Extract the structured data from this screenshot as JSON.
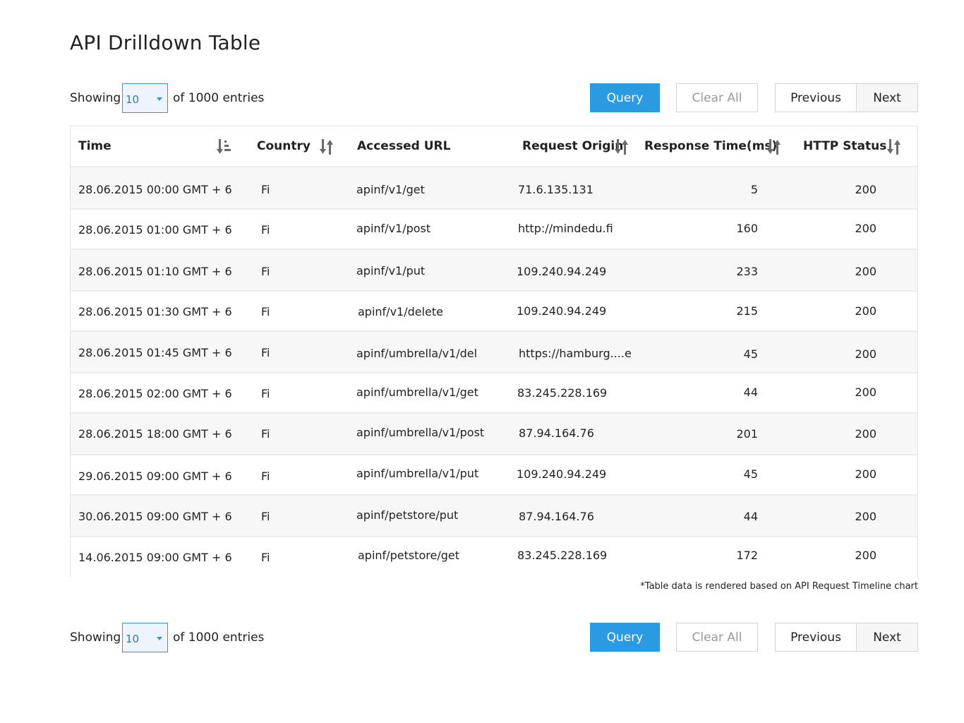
{
  "page": {
    "title": "API Drilldown Table"
  },
  "pagination": {
    "showing_label": "Showing",
    "page_size": "10",
    "entries_label": "of 1000 entries",
    "query_label": "Query",
    "clear_label": "Clear All",
    "previous_label": "Previous",
    "next_label": "Next"
  },
  "table": {
    "columns": [
      {
        "label": "Time",
        "sort_icon": "sort-desc-icon"
      },
      {
        "label": "Country",
        "sort_icon": "sort-icon"
      },
      {
        "label": "Accessed URL",
        "sort_icon": ""
      },
      {
        "label": "Request Origin",
        "sort_icon": "sort-icon"
      },
      {
        "label": "Response Time(ms)",
        "sort_icon": "sort-icon"
      },
      {
        "label": "HTTP Status",
        "sort_icon": "sort-icon"
      }
    ],
    "rows": [
      {
        "time": "28.06.2015  00:00 GMT + 6",
        "country": "Fi",
        "url": "apinf/v1/get",
        "origin": "71.6.135.131",
        "response_time": "5",
        "status": "200"
      },
      {
        "time": "28.06.2015  01:00 GMT + 6",
        "country": "Fi",
        "url": "apinf/v1/post",
        "origin": "http://mindedu.fi",
        "response_time": "160",
        "status": "200"
      },
      {
        "time": "28.06.2015  01:10 GMT + 6",
        "country": "Fi",
        "url": "apinf/v1/put",
        "origin": "109.240.94.249",
        "response_time": "233",
        "status": "200"
      },
      {
        "time": "28.06.2015  01:30 GMT + 6",
        "country": "Fi",
        "url": "apinf/v1/delete",
        "origin": "109.240.94.249",
        "response_time": "215",
        "status": "200"
      },
      {
        "time": "28.06.2015  01:45 GMT + 6",
        "country": "Fi",
        "url": "apinf/umbrella/v1/del",
        "origin": "https://hamburg....e",
        "response_time": "45",
        "status": "200"
      },
      {
        "time": "28.06.2015  02:00 GMT + 6",
        "country": "Fi",
        "url": "apinf/umbrella/v1/get",
        "origin": "83.245.228.169",
        "response_time": "44",
        "status": "200"
      },
      {
        "time": "28.06.2015  18:00 GMT + 6",
        "country": "Fi",
        "url": "apinf/umbrella/v1/post",
        "origin": "87.94.164.76",
        "response_time": "201",
        "status": "200"
      },
      {
        "time": "29.06.2015  09:00 GMT + 6",
        "country": "Fi",
        "url": "apinf/umbrella/v1/put",
        "origin": "109.240.94.249",
        "response_time": "45",
        "status": "200"
      },
      {
        "time": "30.06.2015  09:00 GMT + 6",
        "country": "Fi",
        "url": "apinf/petstore/put",
        "origin": "87.94.164.76",
        "response_time": "44",
        "status": "200"
      },
      {
        "time": "14.06.2015  09:00 GMT + 6",
        "country": "Fi",
        "url": "apinf/petstore/get",
        "origin": "83.245.228.169",
        "response_time": "172",
        "status": "200"
      }
    ]
  },
  "footnote": "*Table data is rendered based on API Request Timeline chart",
  "colors": {
    "accent": "#2a9be2",
    "select_border": "#3a8fd8",
    "row_alt": "#f7f7f7",
    "icon_gray": "#6a6a6a"
  }
}
